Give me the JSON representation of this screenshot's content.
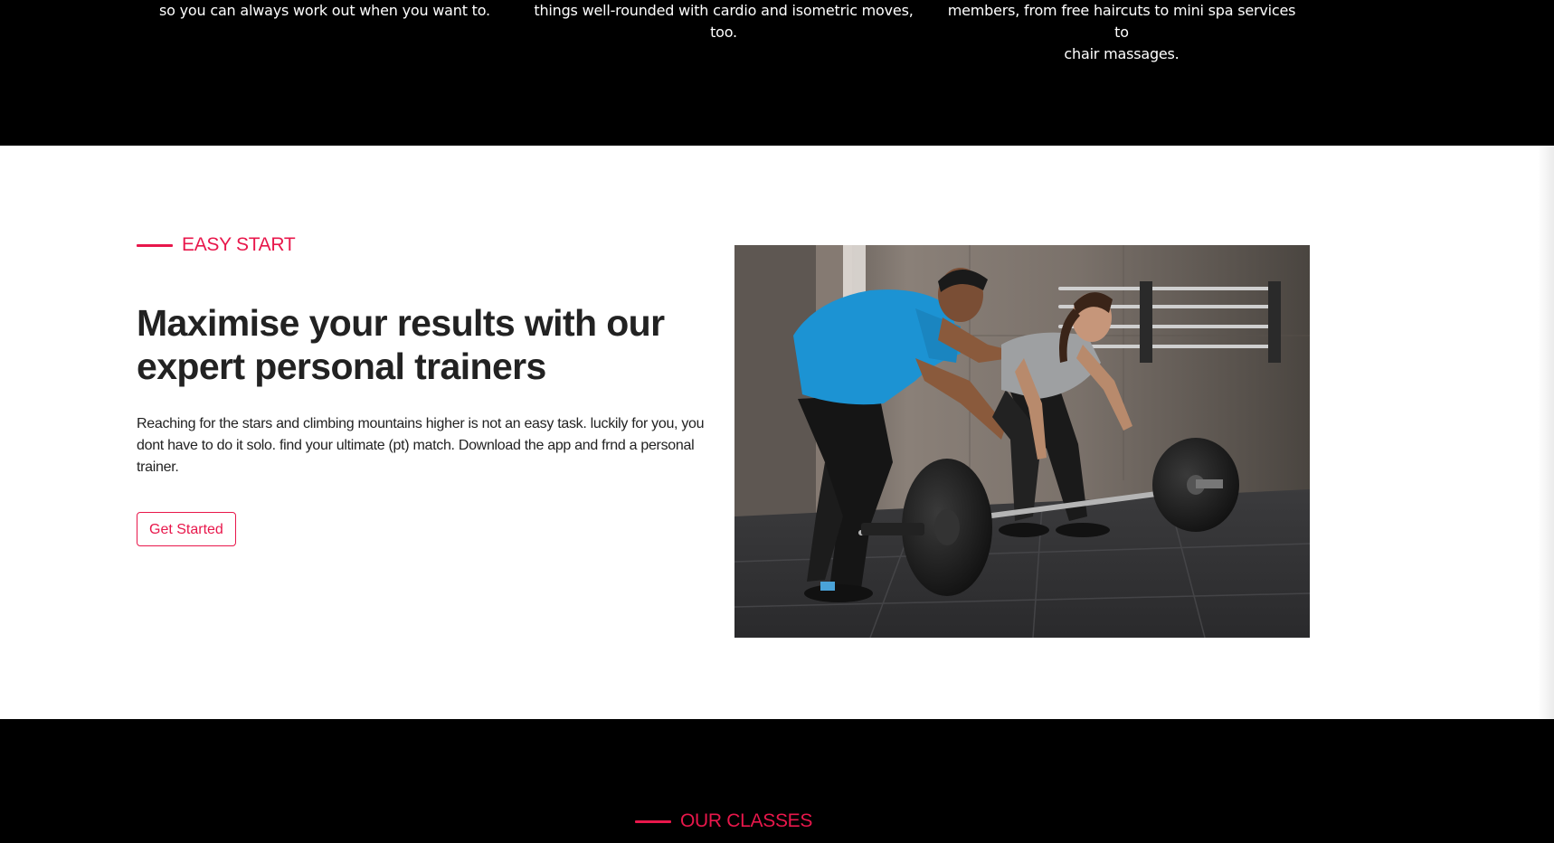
{
  "features": {
    "item1": "so you can always work out when you want to.",
    "item2_line1": "things well-rounded with cardio and isometric moves,",
    "item2_line2": "too.",
    "item3_line1": "members, from free haircuts to mini spa services to",
    "item3_line2": "chair massages."
  },
  "easy_start": {
    "eyebrow": "EASY START",
    "headline_line1": "Maximise your results with our",
    "headline_line2": "expert personal trainers",
    "paragraph": "Reaching for the stars and climbing mountains higher is not an easy task. luckily for you, you dont have to do it solo. find your ultimate (pt) match. Download the app and frnd a personal trainer.",
    "button_label": "Get Started",
    "image_alt": "personal-trainer-deadlift-photo"
  },
  "classes": {
    "eyebrow": "OUR CLASSES"
  },
  "colors": {
    "accent": "#e8174b",
    "dark": "#000000",
    "text": "#222222"
  }
}
